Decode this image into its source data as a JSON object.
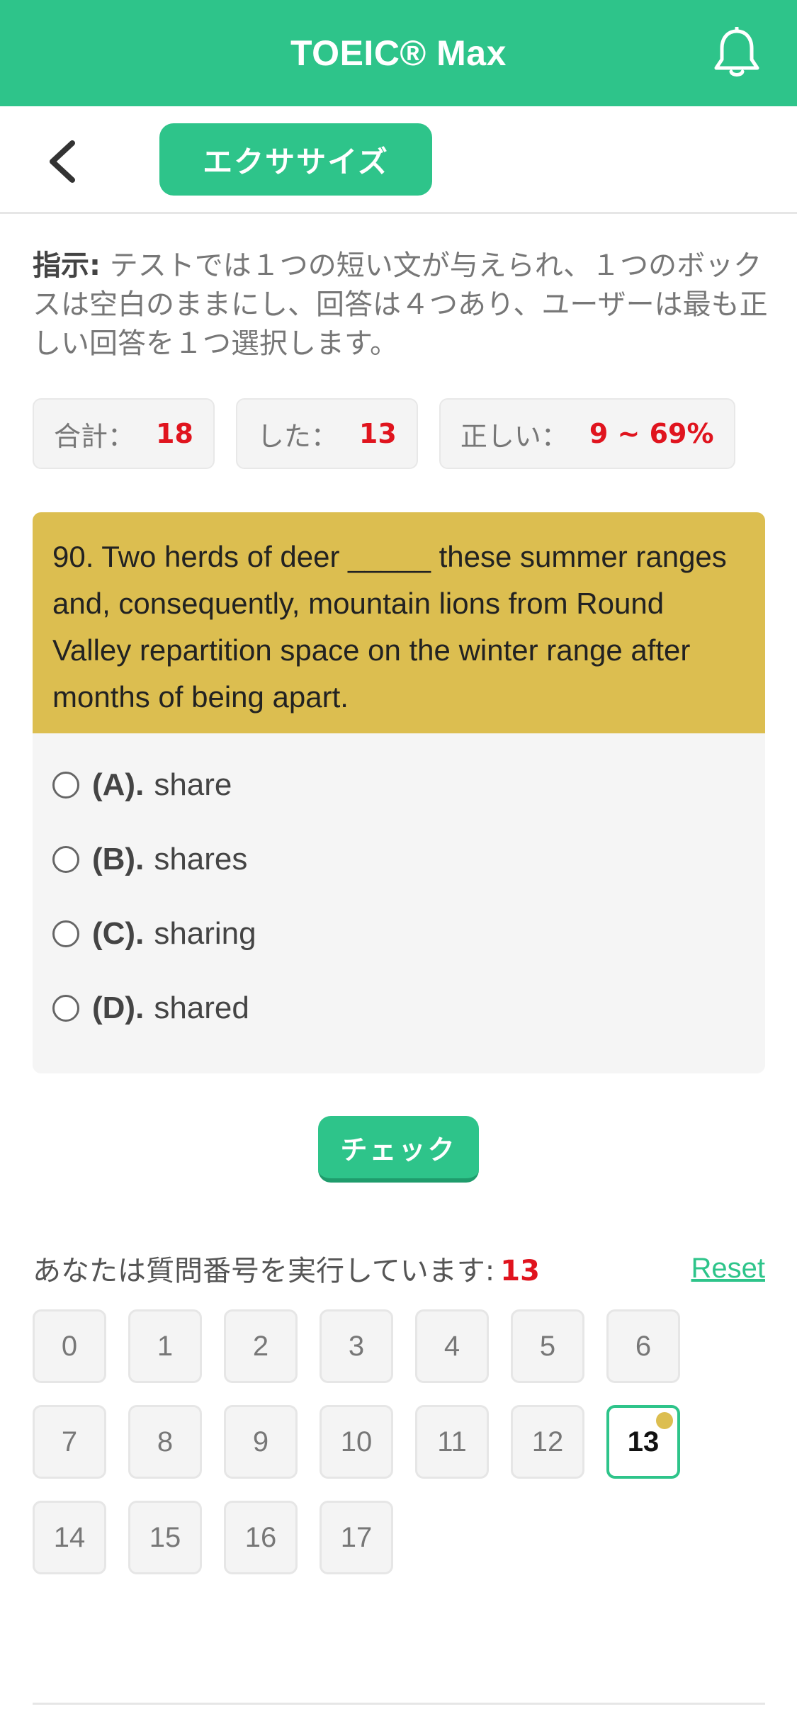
{
  "header": {
    "title": "TOEIC® Max"
  },
  "subnav": {
    "tab_label": "エクササイズ"
  },
  "instructions": {
    "label": "指示:",
    "text": " テストでは１つの短い文が与えられ、１つのボックスは空白のままにし、回答は４つあり、ユーザーは最も正しい回答を１つ選択します。"
  },
  "stats": [
    {
      "label": "合計：",
      "value": "18"
    },
    {
      "label": "した：",
      "value": "13"
    },
    {
      "label": "正しい：",
      "value": "9 ~ 69%"
    }
  ],
  "question": {
    "text": "90. Two herds of deer _____ these summer ranges and, consequently, mountain lions from Round Valley repartition space on the winter range after months of being apart.",
    "options": [
      {
        "letter": "(A).",
        "text": "share"
      },
      {
        "letter": "(B).",
        "text": "shares"
      },
      {
        "letter": "(C).",
        "text": "sharing"
      },
      {
        "letter": "(D).",
        "text": "shared"
      }
    ]
  },
  "check_label": "チェック",
  "progress": {
    "label": "あなたは質問番号を実行しています:",
    "current": "13",
    "reset_label": "Reset"
  },
  "questions_grid": [
    "0",
    "1",
    "2",
    "3",
    "4",
    "5",
    "6",
    "7",
    "8",
    "9",
    "10",
    "11",
    "12",
    "13",
    "14",
    "15",
    "16",
    "17"
  ],
  "colors": {
    "accent": "#2ec48a",
    "question_bg": "#dcbe50",
    "highlight": "#e0141e"
  }
}
